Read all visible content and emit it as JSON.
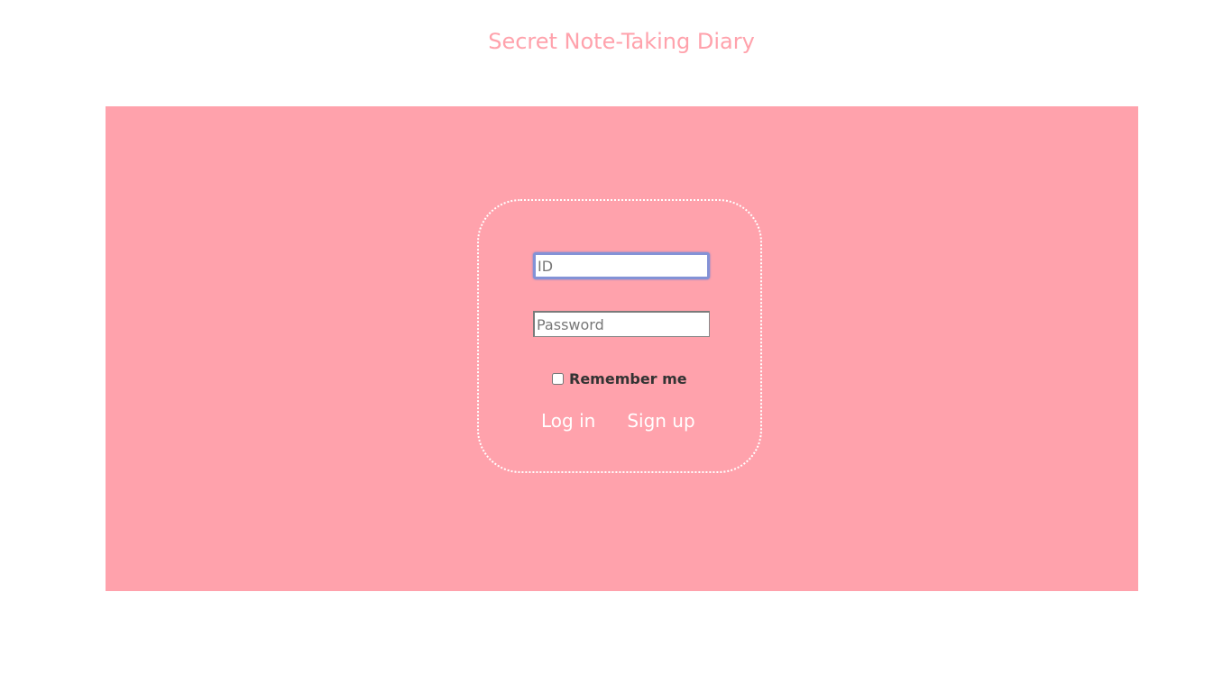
{
  "header": {
    "title": "Secret Note-Taking Diary"
  },
  "login": {
    "id_placeholder": "ID",
    "id_value": "",
    "password_placeholder": "Password",
    "password_value": "",
    "remember_label": "Remember me",
    "remember_checked": false,
    "login_label": "Log in",
    "signup_label": "Sign up"
  },
  "colors": {
    "accent": "#ffa2ac",
    "text_dark": "#333333",
    "focus_border": "#8392d6"
  }
}
